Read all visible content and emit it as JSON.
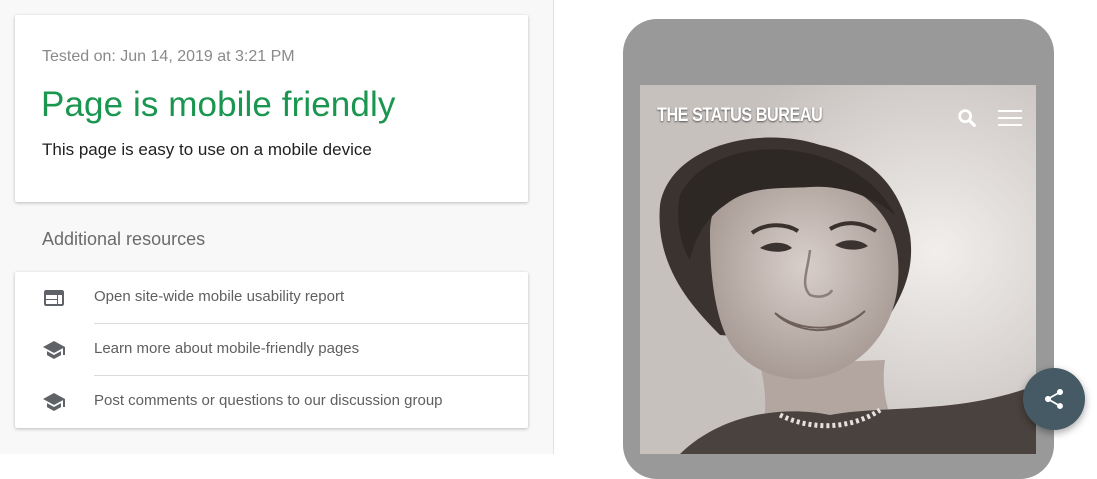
{
  "result": {
    "tested_on": "Tested on: Jun 14, 2019 at 3:21 PM",
    "title": "Page is mobile friendly",
    "description": "This page is easy to use on a mobile device",
    "title_color": "#1a9650"
  },
  "resources": {
    "heading": "Additional resources",
    "items": [
      {
        "label": "Open site-wide mobile usability report",
        "icon": "web-report-icon"
      },
      {
        "label": "Learn more about mobile-friendly pages",
        "icon": "school-icon"
      },
      {
        "label": "Post comments or questions to our discussion group",
        "icon": "school-icon"
      }
    ]
  },
  "preview": {
    "site_name": "THE STATUS BUREAU",
    "icons": [
      "search-icon",
      "hamburger-menu-icon"
    ]
  },
  "fab": {
    "icon": "share-icon",
    "color": "#455a64"
  }
}
